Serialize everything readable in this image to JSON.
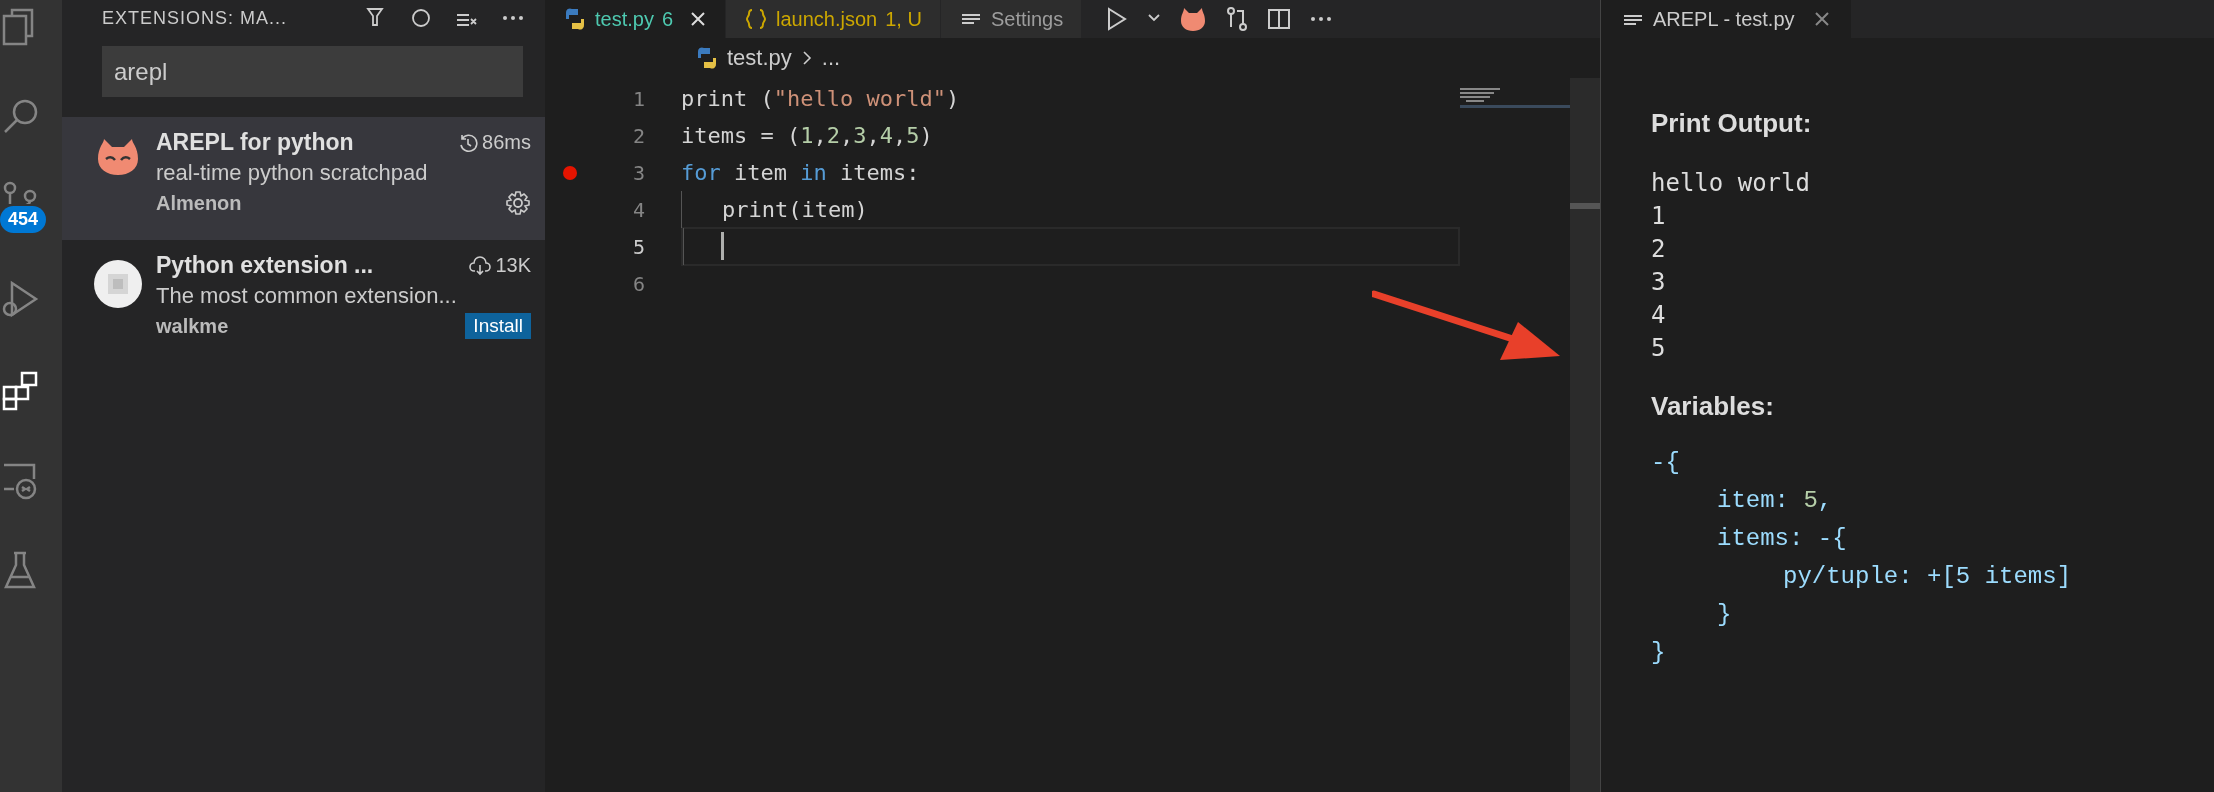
{
  "activity_bar": [
    {
      "kind": "explorer",
      "selected": false
    },
    {
      "kind": "search",
      "selected": false
    },
    {
      "kind": "source-control",
      "selected": false,
      "badge": "454"
    },
    {
      "kind": "run",
      "selected": false
    },
    {
      "kind": "extensions",
      "selected": true
    },
    {
      "kind": "remote",
      "selected": false
    },
    {
      "kind": "testing",
      "selected": false
    }
  ],
  "sidebar": {
    "title": "EXTENSIONS: MA...",
    "actions": [
      {
        "kind": "filter"
      },
      {
        "kind": "refresh"
      },
      {
        "kind": "clear"
      },
      {
        "kind": "more"
      }
    ],
    "search": {
      "value": "arepl"
    },
    "extensions": [
      {
        "kind": "installed",
        "name": "AREPL for python",
        "stat": "86ms",
        "description": "real-time python scratchpad",
        "publisher": "Almenon",
        "selected": true,
        "action": {
          "kind": "gear"
        }
      },
      {
        "kind": "marketplace",
        "name": "Python extension ...",
        "stat": "13K",
        "description": "The most common extension...",
        "publisher": "walkme",
        "selected": false,
        "action": {
          "kind": "install",
          "label": "Install"
        }
      }
    ]
  },
  "editor": {
    "tabs": [
      {
        "kind": "python",
        "label": "test.py",
        "badge": "6",
        "selected": true,
        "color": "#4ec9b0"
      },
      {
        "kind": "json",
        "label": "launch.json",
        "badge": "1, U",
        "selected": false,
        "color": "#cca700"
      },
      {
        "kind": "settings",
        "label": "Settings",
        "selected": false,
        "color": "#9d9d9d"
      }
    ],
    "toolbar": [
      {
        "kind": "run"
      },
      {
        "kind": "caret"
      },
      {
        "kind": "cat"
      },
      {
        "kind": "compare"
      },
      {
        "kind": "split"
      },
      {
        "kind": "more"
      }
    ],
    "breadcrumb": [
      "test.py",
      "..."
    ],
    "lines": [
      {
        "number": "1",
        "breakpoint": false,
        "current": false,
        "tokens": [
          {
            "text": "print (",
            "kind": "plain"
          },
          {
            "text": "\"hello world\"",
            "kind": "string"
          },
          {
            "text": ")",
            "kind": "plain"
          }
        ]
      },
      {
        "number": "2",
        "breakpoint": false,
        "current": false,
        "tokens": [
          {
            "text": "items = (",
            "kind": "plain"
          },
          {
            "text": "1",
            "kind": "number"
          },
          {
            "text": ",",
            "kind": "plain"
          },
          {
            "text": "2",
            "kind": "number"
          },
          {
            "text": ",",
            "kind": "plain"
          },
          {
            "text": "3",
            "kind": "number"
          },
          {
            "text": ",",
            "kind": "plain"
          },
          {
            "text": "4",
            "kind": "number"
          },
          {
            "text": ",",
            "kind": "plain"
          },
          {
            "text": "5",
            "kind": "number"
          },
          {
            "text": ")",
            "kind": "plain"
          }
        ]
      },
      {
        "number": "3",
        "breakpoint": true,
        "current": false,
        "tokens": [
          {
            "text": "for",
            "kind": "keyword"
          },
          {
            "text": " item ",
            "kind": "plain"
          },
          {
            "text": "in",
            "kind": "keyword"
          },
          {
            "text": " items:",
            "kind": "plain"
          }
        ]
      },
      {
        "number": "4",
        "breakpoint": false,
        "current": false,
        "indent": true,
        "tokens": [
          {
            "text": "print(item)",
            "kind": "plain"
          }
        ]
      },
      {
        "number": "5",
        "breakpoint": false,
        "current": true,
        "indent": true
      },
      {
        "number": "6",
        "breakpoint": false,
        "current": false
      }
    ]
  },
  "panel": {
    "tab": {
      "label": "AREPL - test.py",
      "selected": true
    },
    "print_title": "Print Output:",
    "output": [
      "hello world",
      "1",
      "2",
      "3",
      "4",
      "5"
    ],
    "variables_title": "Variables:",
    "variables": {
      "open": "-{",
      "children": [
        {
          "tokens": [
            {
              "text": "item: ",
              "kind": "key"
            },
            {
              "text": "5",
              "kind": "number"
            },
            {
              "text": ",",
              "kind": "key"
            }
          ]
        },
        {
          "open": "items: -{",
          "children": [
            {
              "tokens": [
                {
                  "text": "py/tuple: +[5 items]",
                  "kind": "key"
                }
              ]
            }
          ],
          "close": "}"
        }
      ],
      "close": "}"
    }
  },
  "annotation": {
    "kind": "arrow"
  }
}
